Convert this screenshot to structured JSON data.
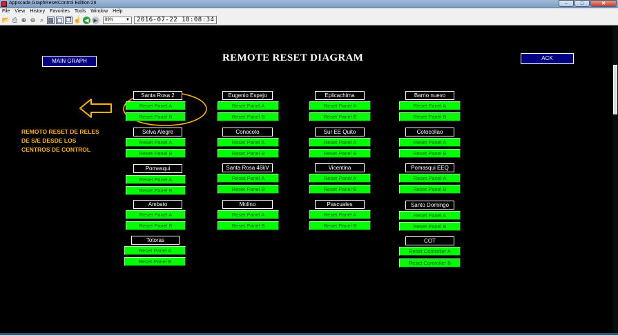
{
  "window": {
    "title": "Appscada  GraphResetControl  Edition:26",
    "buttons": {
      "minimize": "–",
      "maximize": "□",
      "close": "✕"
    }
  },
  "menu": [
    "File",
    "View",
    "History",
    "Favorites",
    "Tools",
    "Window",
    "Help"
  ],
  "toolbar": {
    "zoom": "89%",
    "datetime": "2016-07-22  10:08:34",
    "icons": [
      "folder-open-icon",
      "print-icon",
      "zoom-in-icon",
      "zoom-out-icon",
      "zoom-fit-icon",
      "grid-icon",
      "window-icon",
      "copy-icon",
      "hand-icon",
      "back-icon",
      "forward-icon"
    ]
  },
  "page": {
    "title": "REMOTE RESET DIAGRAM",
    "main_graph_label": "MAIN GRAPH",
    "ack_label": "ACK",
    "annotation_lines": [
      "REMOTO RESET DE RELES",
      "DE S/E DESDE LOS",
      "CENTROS DE CONTROL"
    ],
    "colors": {
      "background": "#000000",
      "button_green": "#00ff00",
      "nav_blue": "#000080",
      "annotation": "#ffb400"
    }
  },
  "substations": [
    {
      "name": "Santa Rosa 2",
      "buttons": [
        "Reset Panel A",
        "Reset Panel B"
      ]
    },
    {
      "name": "Selva Alegre",
      "buttons": [
        "Reset Panel A",
        "Reset Panel B"
      ]
    },
    {
      "name": "Pomasqui",
      "buttons": [
        "Reset Panel A",
        "Reset Panel B"
      ]
    },
    {
      "name": "Ambato",
      "buttons": [
        "Reset Panel A",
        "Reset Panel B"
      ]
    },
    {
      "name": "Totoras",
      "buttons": [
        "Reset Panel A",
        "Reset Panel B"
      ]
    },
    {
      "name": "Eugenio Espejo",
      "buttons": [
        "Reset Panel A",
        "Reset Panel B"
      ]
    },
    {
      "name": "Conocoto",
      "buttons": [
        "Reset Panel A",
        "Reset Panel B"
      ]
    },
    {
      "name": "Santa Rosa 46kV",
      "buttons": [
        "Reset Panel A",
        "Reset Panel B"
      ]
    },
    {
      "name": "Molino",
      "buttons": [
        "Reset Panel A",
        "Reset Panel B"
      ]
    },
    {
      "name": "Eplicachima",
      "buttons": [
        "Reset Panel A",
        "Reset Panel B"
      ]
    },
    {
      "name": "Sur EE Quito",
      "buttons": [
        "Reset Panel A",
        "Reset Panel B"
      ]
    },
    {
      "name": "Vicentina",
      "buttons": [
        "Reset Panel A",
        "Reset Panel B"
      ]
    },
    {
      "name": "Pascuales",
      "buttons": [
        "Reset Panel A",
        "Reset Panel B"
      ]
    },
    {
      "name": "Barrio nuevo",
      "buttons": [
        "Reset Panel A",
        "Reset Panel B"
      ]
    },
    {
      "name": "Cotocollao",
      "buttons": [
        "Reset Panel A",
        "Reset Panel B"
      ]
    },
    {
      "name": "Pomasqui EEQ",
      "buttons": [
        "Reset Panel A",
        "Reset Panel B"
      ]
    },
    {
      "name": "Santo Domingo",
      "buttons": [
        "Reset Panel A",
        "Reset Panel B"
      ]
    },
    {
      "name": "COT",
      "buttons": [
        "Reset Controller A",
        "Reset Controller B"
      ]
    }
  ]
}
